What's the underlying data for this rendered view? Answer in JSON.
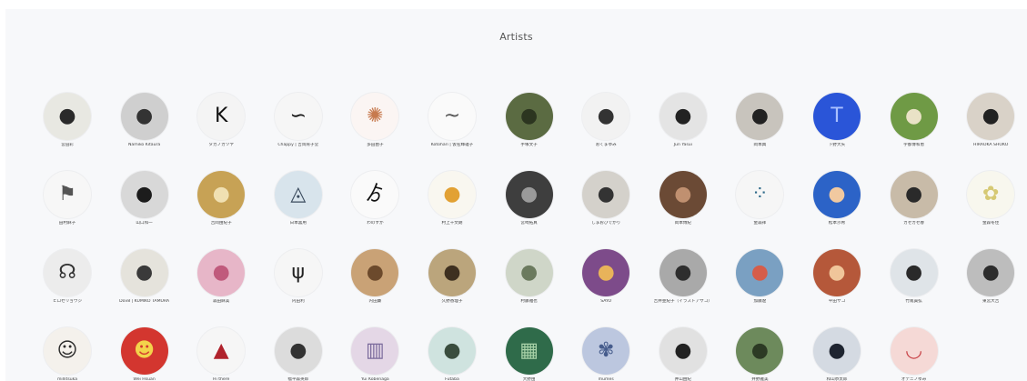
{
  "section": {
    "title": "Artists"
  },
  "artists": [
    {
      "name": "宮田彩",
      "bg": "#e8e8e2",
      "fg": "#2a2a2a",
      "glyph": "●"
    },
    {
      "name": "Namiko Kitaura",
      "bg": "#cfcfcf",
      "fg": "#333333",
      "glyph": "●"
    },
    {
      "name": "タカノカツヤ",
      "bg": "#f4f4f4",
      "fg": "#111111",
      "glyph": "K"
    },
    {
      "name": "Chappy | 吉岡育子堂",
      "bg": "#f6f6f6",
      "fg": "#111111",
      "glyph": "∽"
    },
    {
      "name": "多田由子",
      "bg": "#fbf5f3",
      "fg": "#c77a4e",
      "glyph": "✺"
    },
    {
      "name": "Kotohari | 仮名輝雄子",
      "bg": "#fafafa",
      "fg": "#555555",
      "glyph": "~"
    },
    {
      "name": "手塚文子",
      "bg": "#5b6b42",
      "fg": "#2c3520",
      "glyph": "●"
    },
    {
      "name": "おくまゆみ",
      "bg": "#f2f2f2",
      "fg": "#333333",
      "glyph": "●"
    },
    {
      "name": "Jun Yasui",
      "bg": "#e4e4e4",
      "fg": "#222222",
      "glyph": "●"
    },
    {
      "name": "岡本典",
      "bg": "#c8c4bd",
      "fg": "#222222",
      "glyph": "●"
    },
    {
      "name": "下野大矢",
      "bg": "#2a55d8",
      "fg": "#a9c0ff",
      "glyph": "T"
    },
    {
      "name": "宇都博和恵",
      "bg": "#6f9a45",
      "fg": "#e9e2c6",
      "glyph": "●"
    },
    {
      "name": "HIRAOKA SHOKO",
      "bg": "#d9d2c8",
      "fg": "#222222",
      "glyph": "●"
    },
    {
      "name": "田村麻子",
      "bg": "#f7f7f7",
      "fg": "#555555",
      "glyph": "⚑"
    },
    {
      "name": "山口和一",
      "bg": "#d8d8d8",
      "fg": "#1c1c1c",
      "glyph": "●"
    },
    {
      "name": "吉岡由紀子",
      "bg": "#c7a255",
      "fg": "#f0e0b2",
      "glyph": "●"
    },
    {
      "name": "日本喜用",
      "bg": "#d8e4ec",
      "fg": "#3b4b5e",
      "glyph": "◬"
    },
    {
      "name": "わのすか",
      "bg": "#fafafa",
      "fg": "#111111",
      "glyph": "ゟ"
    },
    {
      "name": "村上千文朗",
      "bg": "#f9f7f0",
      "fg": "#e2a134",
      "glyph": "●"
    },
    {
      "name": "宮崎拓真",
      "bg": "#3e3e3e",
      "fg": "#9a9a9a",
      "glyph": "●"
    },
    {
      "name": "しまおひでかり",
      "bg": "#d4d1cb",
      "fg": "#333333",
      "glyph": "●"
    },
    {
      "name": "岡本博紀",
      "bg": "#6b4a35",
      "fg": "#c09070",
      "glyph": "●"
    },
    {
      "name": "金森祥",
      "bg": "#f6f6f6",
      "fg": "#2f6a8a",
      "glyph": "⁘"
    },
    {
      "name": "松本沙希",
      "bg": "#2c63c7",
      "fg": "#f1c9a0",
      "glyph": "●"
    },
    {
      "name": "カゼカゼ春",
      "bg": "#c8bba8",
      "fg": "#2a2a2a",
      "glyph": "●"
    },
    {
      "name": "金森冬佳",
      "bg": "#f8f7ee",
      "fg": "#d6c974",
      "glyph": "✿"
    },
    {
      "name": "ヒロセリョウジ",
      "bg": "#ececec",
      "fg": "#333333",
      "glyph": "☊"
    },
    {
      "name": "Dov8 | KUMIKO TAMURA",
      "bg": "#e5e3dc",
      "fg": "#3a3a3a",
      "glyph": "●"
    },
    {
      "name": "森田麻美",
      "bg": "#e7b6c8",
      "fg": "#c05a7c",
      "glyph": "●"
    },
    {
      "name": "内田利",
      "bg": "#f6f6f6",
      "fg": "#222222",
      "glyph": "ψ"
    },
    {
      "name": "内田廉",
      "bg": "#c9a276",
      "fg": "#6c4a2c",
      "glyph": "●"
    },
    {
      "name": "久野香理子",
      "bg": "#bba57c",
      "fg": "#3e3020",
      "glyph": "●"
    },
    {
      "name": "村藤雅也",
      "bg": "#cfd6c8",
      "fg": "#6b7a5e",
      "glyph": "●"
    },
    {
      "name": "SAYO",
      "bg": "#7d4b8a",
      "fg": "#e8b35a",
      "glyph": "●"
    },
    {
      "name": "吉井亜紀子（イラストアサコ）",
      "bg": "#a9a9a9",
      "fg": "#2e2e2e",
      "glyph": "●"
    },
    {
      "name": "加藤遼",
      "bg": "#7aa0c2",
      "fg": "#d55d4a",
      "glyph": "●"
    },
    {
      "name": "平田サコ",
      "bg": "#b5583a",
      "fg": "#f0c59a",
      "glyph": "●"
    },
    {
      "name": "竹尾貴弘",
      "bg": "#dfe4e8",
      "fg": "#2a2a2a",
      "glyph": "●"
    },
    {
      "name": "東宮大吉",
      "bg": "#bdbdbd",
      "fg": "#2d2d2d",
      "glyph": "●"
    },
    {
      "name": "millitsuka",
      "bg": "#f4f1ec",
      "fg": "#2b2b2b",
      "glyph": "☺"
    },
    {
      "name": "Wei Hsuan",
      "bg": "#d3362f",
      "fg": "#f3d34b",
      "glyph": "☻"
    },
    {
      "name": "Hi there",
      "bg": "#f6f6f6",
      "fg": "#b0222c",
      "glyph": "▲"
    },
    {
      "name": "福平森英郎",
      "bg": "#dcdcdc",
      "fg": "#333333",
      "glyph": "●"
    },
    {
      "name": "Yui Kobenaga",
      "bg": "#e4d7e6",
      "fg": "#7a6a9b",
      "glyph": "▥"
    },
    {
      "name": "Futaba",
      "bg": "#cfe3df",
      "fg": "#3a4d3e",
      "glyph": "●"
    },
    {
      "name": "大野由",
      "bg": "#2f6b4a",
      "fg": "#a8d2a8",
      "glyph": "▦"
    },
    {
      "name": "mumes",
      "bg": "#bcc7df",
      "fg": "#465c8c",
      "glyph": "✾"
    },
    {
      "name": "井山由紀",
      "bg": "#e1e1e1",
      "fg": "#222222",
      "glyph": "●"
    },
    {
      "name": "井野雅美",
      "bg": "#6d8a5c",
      "fg": "#2c3a24",
      "glyph": "●"
    },
    {
      "name": "和山恭太郎",
      "bg": "#d4dae2",
      "fg": "#1e2430",
      "glyph": "●"
    },
    {
      "name": "オテニノゆみ",
      "bg": "#f5d9d6",
      "fg": "#c9454a",
      "glyph": "◡"
    }
  ]
}
